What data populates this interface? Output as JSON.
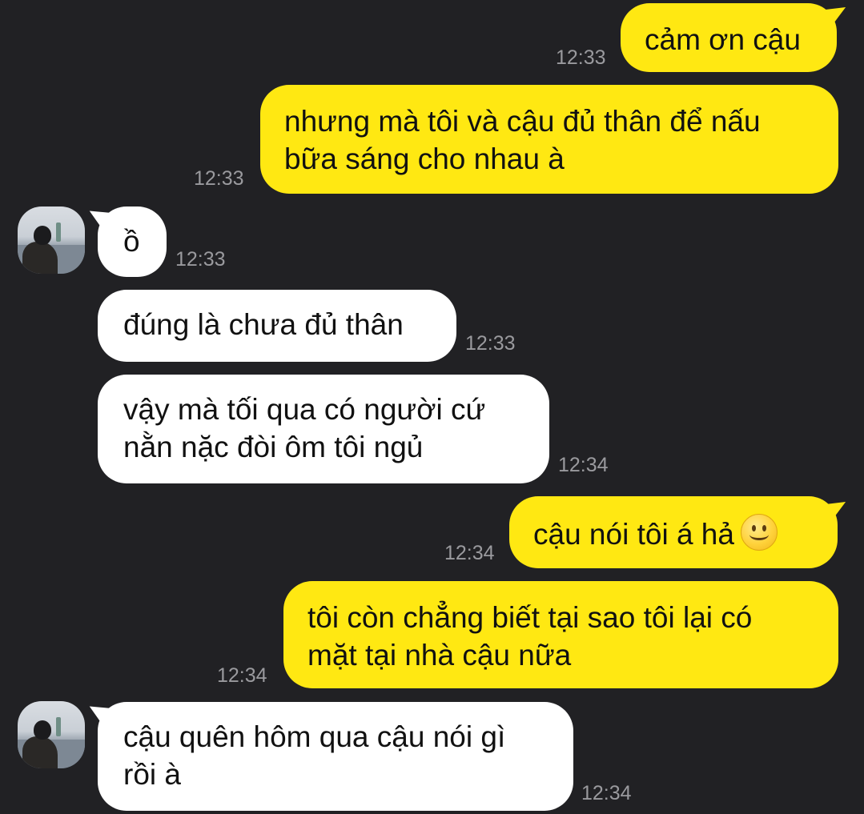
{
  "messages": [
    {
      "sender": "me",
      "lines": [
        "cảm ơn cậu"
      ],
      "time": "12:33"
    },
    {
      "sender": "me",
      "lines": [
        "nhưng mà tôi và cậu đủ thân để nấu",
        "bữa sáng cho nhau à"
      ],
      "time": "12:33"
    },
    {
      "sender": "friend",
      "lines": [
        "ồ"
      ],
      "time": "12:33"
    },
    {
      "sender": "friend",
      "lines": [
        "đúng là chưa đủ thân"
      ],
      "time": "12:33"
    },
    {
      "sender": "friend",
      "lines": [
        "vậy mà tối qua có người cứ",
        "nằn nặc đòi ôm tôi ngủ"
      ],
      "time": "12:34"
    },
    {
      "sender": "me",
      "lines": [
        "cậu nói tôi á hả"
      ],
      "emoji": "slightly-smiling-face-icon",
      "time": "12:34"
    },
    {
      "sender": "me",
      "lines": [
        "tôi còn chẳng biết tại sao tôi lại có",
        "mặt tại nhà cậu nữa"
      ],
      "time": "12:34"
    },
    {
      "sender": "friend",
      "lines": [
        "cậu quên hôm qua cậu nói gì",
        "rồi à"
      ],
      "time": "12:34"
    }
  ],
  "colors": {
    "background": "#212124",
    "outgoing_bubble": "#ffe812",
    "incoming_bubble": "#ffffff",
    "timestamp": "#9a9a9e",
    "text": "#111111"
  }
}
